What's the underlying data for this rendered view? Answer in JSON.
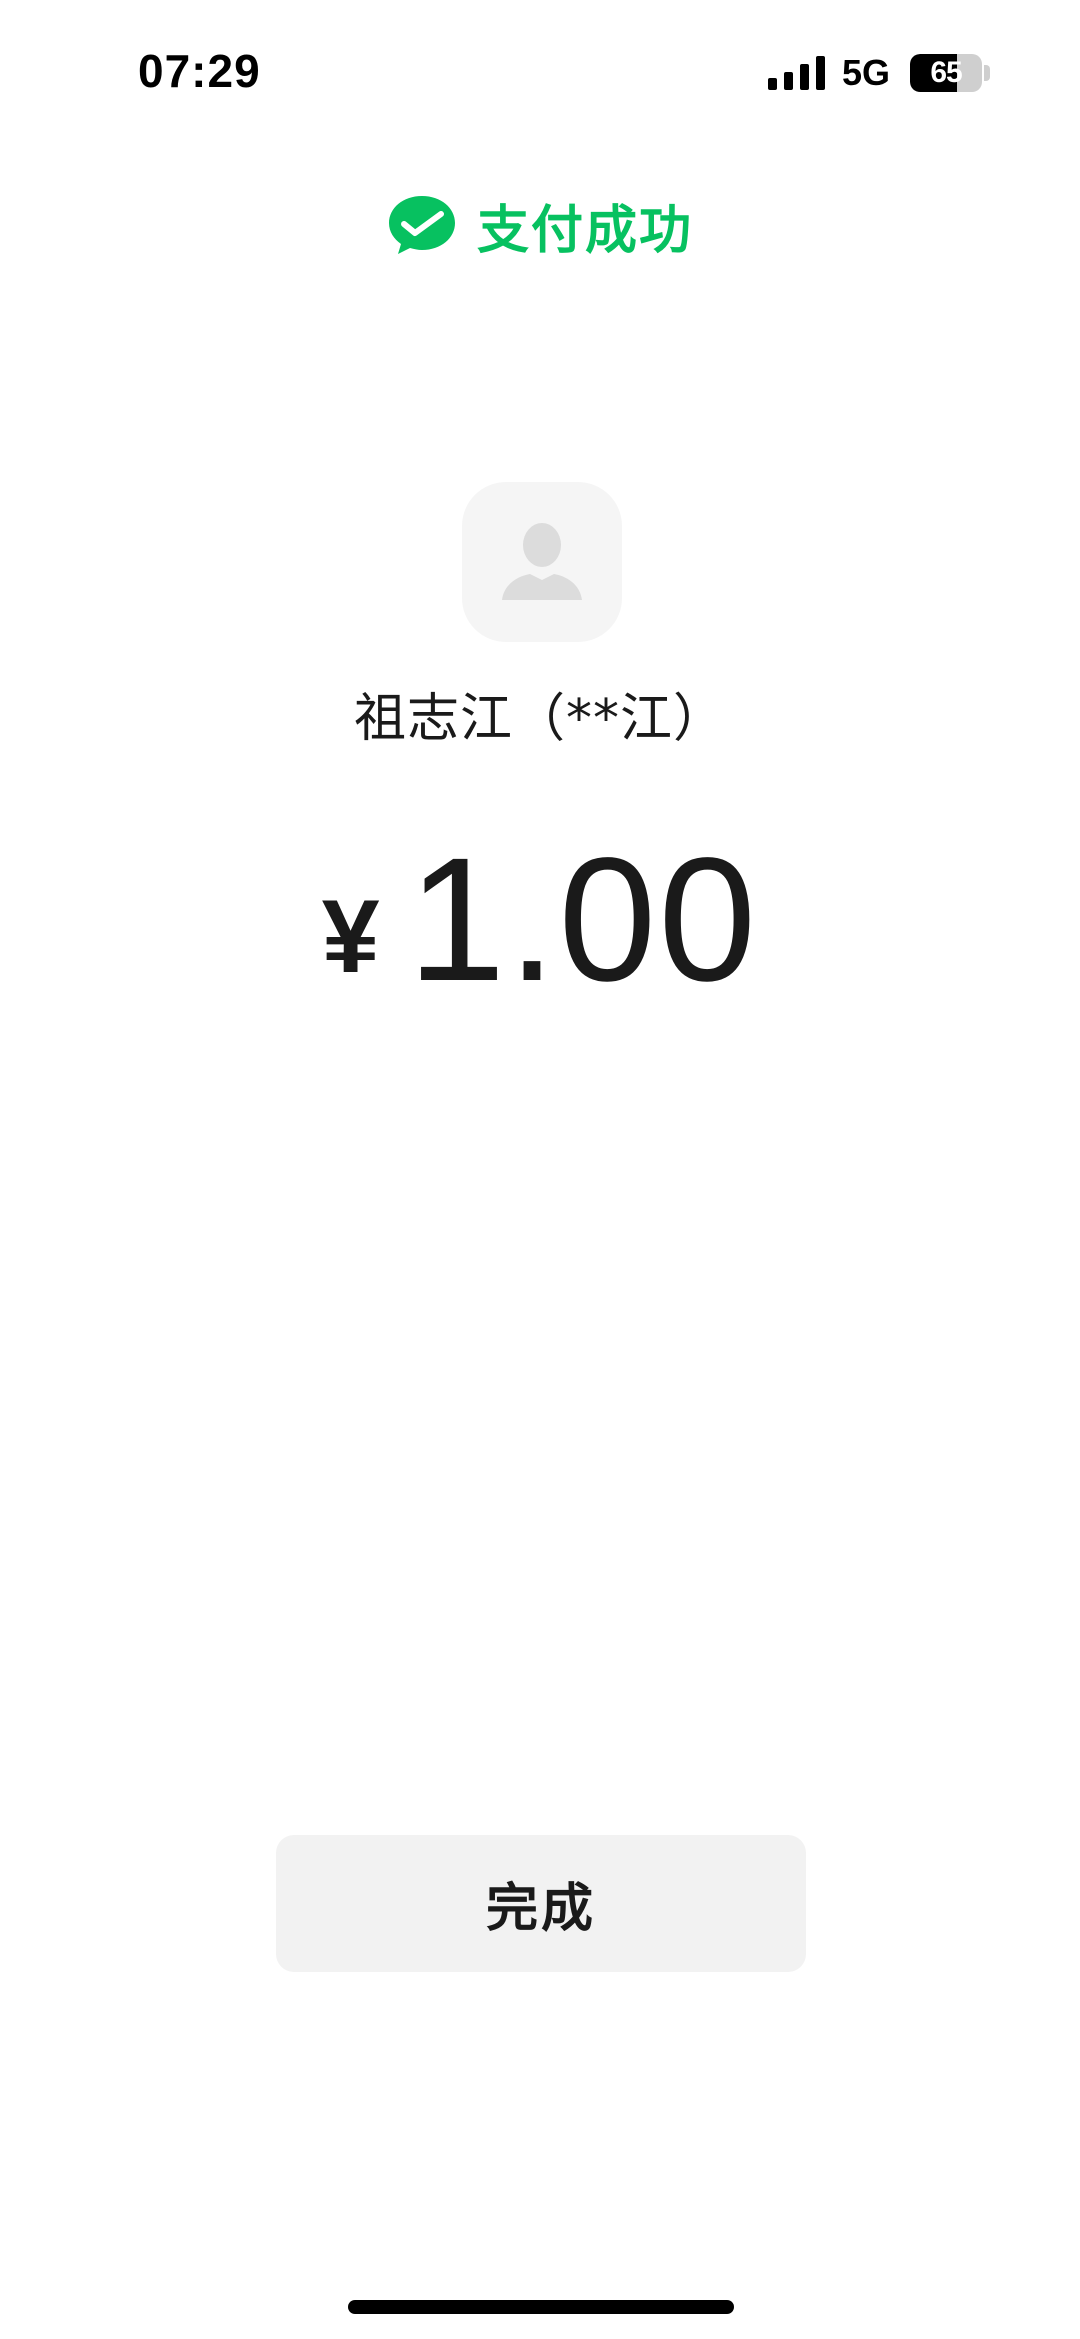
{
  "status_bar": {
    "time": "07:29",
    "network": "5G",
    "battery_level": "65",
    "battery_fraction": 0.65,
    "signal_icon": "signal-bars-icon"
  },
  "header": {
    "title": "支付成功",
    "logo_icon": "wechat-pay-check-icon",
    "accent_color": "#07c160"
  },
  "payee": {
    "avatar_icon": "default-user-avatar-icon",
    "name": "祖志江（**江）"
  },
  "payment": {
    "currency_symbol": "¥",
    "amount": "1.00"
  },
  "actions": {
    "done_label": "完成"
  }
}
